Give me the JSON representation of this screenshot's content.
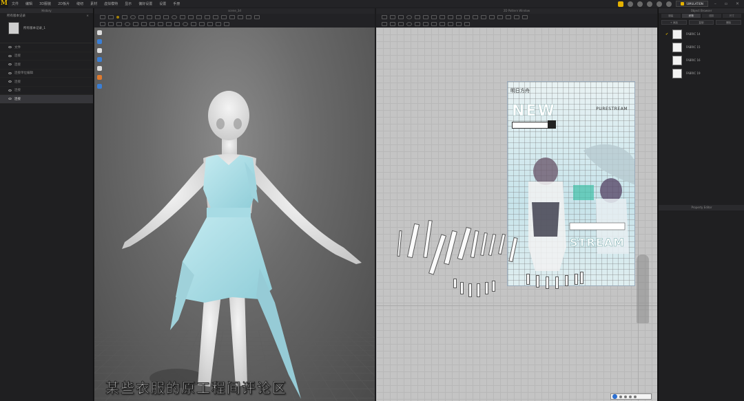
{
  "app": {
    "logo_text": "M",
    "menu": [
      "文件",
      "编辑",
      "3D服装",
      "2D板片",
      "缝纫",
      "素材",
      "虚拟模特",
      "显示",
      "偏好设置",
      "设置",
      "手册"
    ]
  },
  "left_panel": {
    "title": "History",
    "subtitle": "所有版本记录",
    "close_glyph": "×",
    "thumb_label": "所有版本记录_1",
    "items": [
      {
        "label": "文件"
      },
      {
        "label": "连接"
      },
      {
        "label": "连接"
      },
      {
        "label": "连接单位编辑"
      },
      {
        "label": "连接"
      },
      {
        "label": "连接"
      },
      {
        "label": "连接"
      }
    ]
  },
  "window_3d": {
    "title": "scene_3d",
    "subtitle": "某些衣服的原工程间评论区"
  },
  "window_2d": {
    "title": "2D Pattern Window",
    "poster": {
      "logo": "明日方舟",
      "headline": "NEW",
      "brand": "PURESTREAM",
      "stream": "STREAM"
    }
  },
  "right_panel": {
    "title": "Object Browser",
    "tabs": [
      "服装",
      "织物",
      "纽扣",
      "尺寸"
    ],
    "buttons": [
      "+ 添加",
      "复制",
      "删除"
    ],
    "fabrics": [
      "FABRIC 14",
      "FABRIC 15",
      "FABRIC 16",
      "FABRIC 19"
    ],
    "property_title": "Property Editor"
  },
  "toolbar": {
    "sim_label": "SIMULATION"
  },
  "colors": {
    "accent": "#e4b100",
    "panel_bg": "#1f1f21",
    "dress": "#b4e0e8",
    "viewport_bg": "#6b6b6b",
    "pattern_bg": "#c4c4c4"
  }
}
